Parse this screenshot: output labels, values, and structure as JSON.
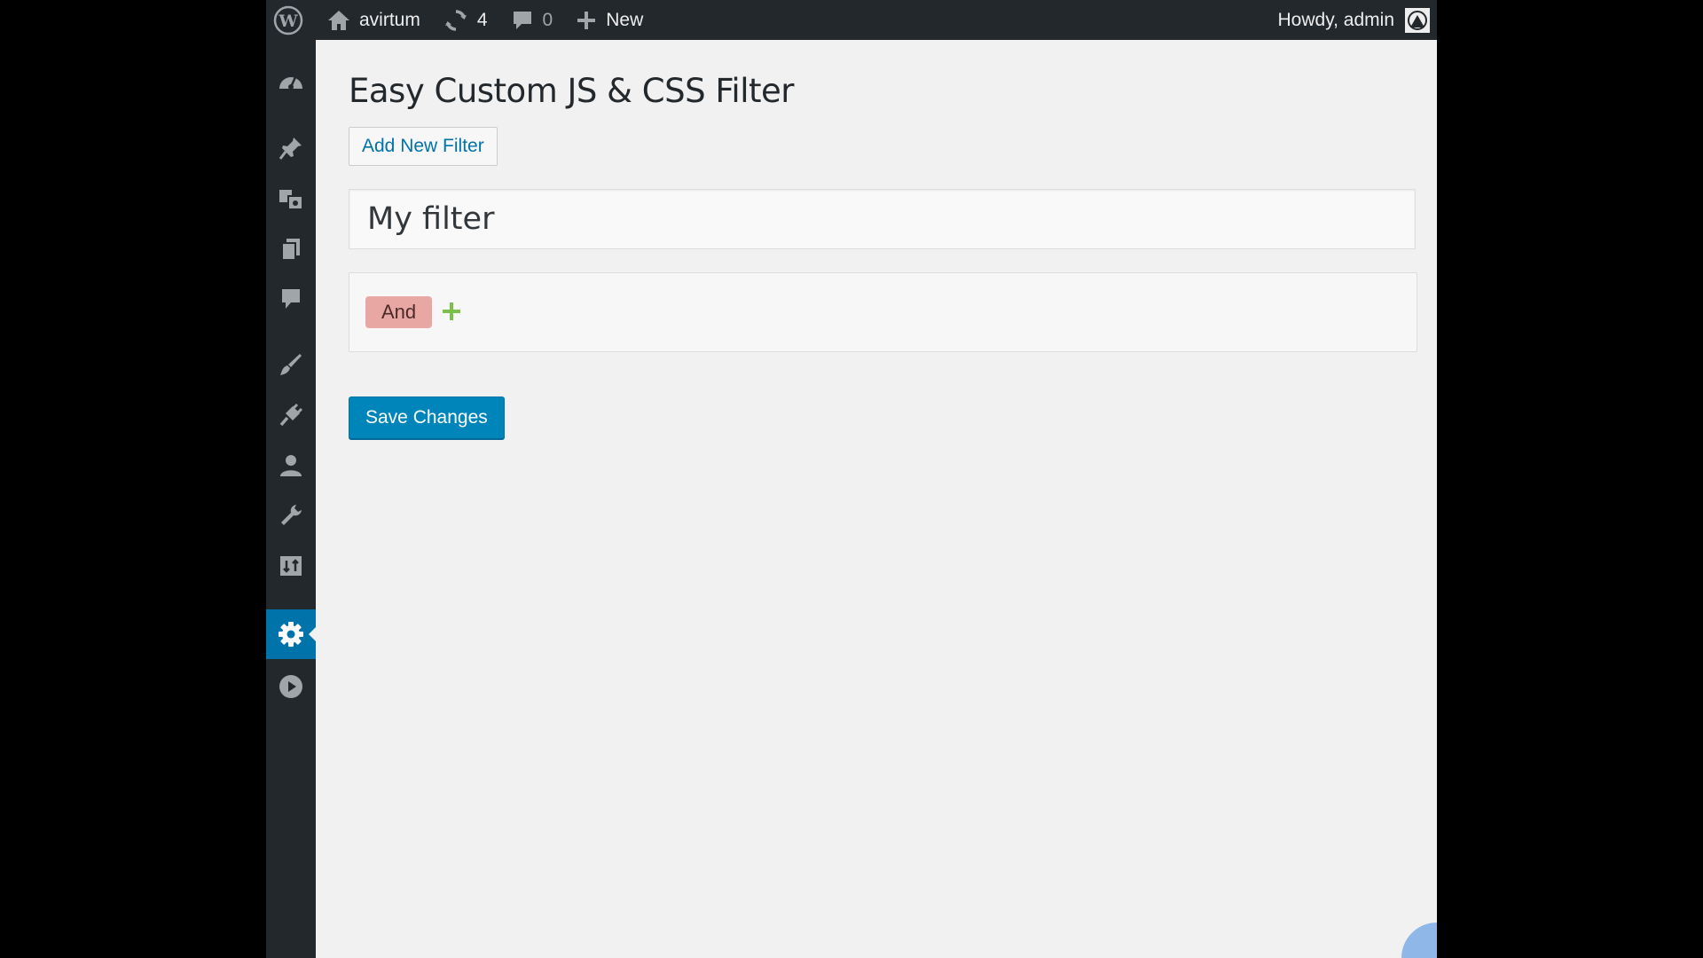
{
  "admin_bar": {
    "site_name": "avirtum",
    "updates_count": "4",
    "comments_count": "0",
    "new_label": "New",
    "greeting": "Howdy, admin"
  },
  "side_menu": {
    "items": [
      {
        "icon": "dashboard-icon"
      },
      {
        "icon": "pin-icon"
      },
      {
        "icon": "media-icon"
      },
      {
        "icon": "pages-icon"
      },
      {
        "icon": "comments-icon"
      },
      {
        "icon": "appearance-icon"
      },
      {
        "icon": "plugins-icon"
      },
      {
        "icon": "users-icon"
      },
      {
        "icon": "tools-icon"
      },
      {
        "icon": "import-icon"
      },
      {
        "icon": "settings-icon",
        "current": true
      },
      {
        "icon": "play-icon"
      }
    ],
    "accent_color": "#0073aa"
  },
  "page": {
    "title": "Easy Custom JS & CSS Filter",
    "add_new_label": "Add New Filter",
    "filter_name_value": "My filter",
    "logic_badge": "And",
    "add_rule_symbol": "+",
    "save_label": "Save Changes"
  },
  "colors": {
    "admin_bar_bg": "#23282d",
    "primary_button": "#0085ba",
    "and_badge": "#e8a7a3",
    "add_rule": "#7cbf4a"
  }
}
